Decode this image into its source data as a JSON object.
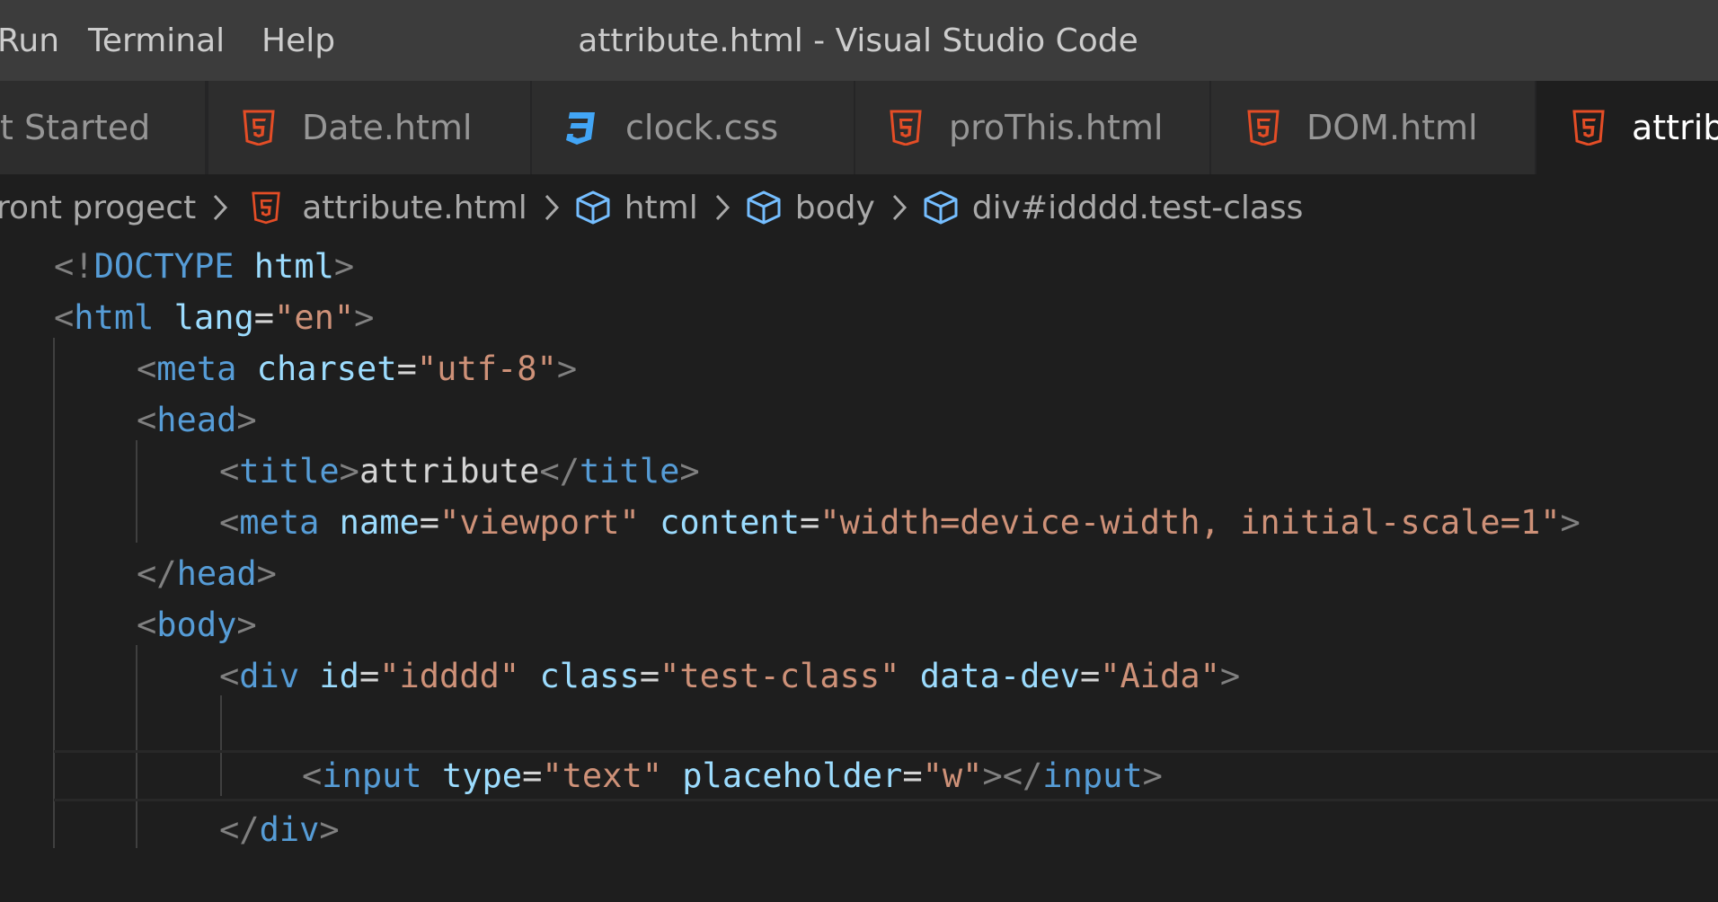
{
  "window": {
    "title": "attribute.html - Visual Studio Code"
  },
  "menu": {
    "run": "Run",
    "terminal": "Terminal",
    "help": "Help"
  },
  "tabs": [
    {
      "label": "t Started",
      "icon": "vscode-welcome-icon",
      "active": false
    },
    {
      "label": "Date.html",
      "icon": "html5-icon",
      "active": false
    },
    {
      "label": "clock.css",
      "icon": "css3-icon",
      "active": false
    },
    {
      "label": "proThis.html",
      "icon": "html5-icon",
      "active": false
    },
    {
      "label": "DOM.html",
      "icon": "html5-icon",
      "active": false
    },
    {
      "label": "attribu",
      "icon": "html5-icon",
      "active": true
    }
  ],
  "breadcrumb": {
    "folder": "ront progect",
    "file": "attribute.html",
    "html": "html",
    "body": "body",
    "div": "div#idddd.test-class"
  },
  "code": {
    "l1": {
      "open": "<!",
      "doctype": "DOCTYPE",
      "html": "html",
      "close": ">"
    },
    "l2": {
      "lt": "<",
      "tag": "html",
      "attr": "lang",
      "eq": "=",
      "val": "\"en\"",
      "gt": ">"
    },
    "l3": {
      "lt": "<",
      "tag": "meta",
      "attr": "charset",
      "eq": "=",
      "val": "\"utf-8\"",
      "gt": ">"
    },
    "l4": {
      "lt": "<",
      "tag": "head",
      "gt": ">"
    },
    "l5": {
      "lt": "<",
      "tag": "title",
      "gt": ">",
      "text": "attribute",
      "lt2": "</",
      "tag2": "title",
      "gt2": ">"
    },
    "l6": {
      "lt": "<",
      "tag": "meta",
      "attr1": "name",
      "eq": "=",
      "val1": "\"viewport\"",
      "attr2": "content",
      "val2": "\"width=device-width, initial-scale=1\"",
      "gt": ">"
    },
    "l7": {
      "lt": "</",
      "tag": "head",
      "gt": ">"
    },
    "l8": {
      "lt": "<",
      "tag": "body",
      "gt": ">"
    },
    "l9": {
      "lt": "<",
      "tag": "div",
      "attr1": "id",
      "eq": "=",
      "val1": "\"idddd\"",
      "attr2": "class",
      "val2": "\"test-class\"",
      "attr3": "data-dev",
      "val3": "\"Aida\"",
      "gt": ">"
    },
    "l11": {
      "lt": "<",
      "tag": "input",
      "attr1": "type",
      "eq": "=",
      "val1": "\"text\"",
      "attr2": "placeholder",
      "val2": "\"w\"",
      "gt": ">",
      "lt2": "</",
      "tag2": "input",
      "gt2": ">"
    },
    "l12": {
      "lt": "</",
      "tag": "div",
      "gt": ">"
    }
  },
  "colors": {
    "titlebar": "#3c3c3c",
    "tab_inactive": "#2d2d2d",
    "editor_bg": "#1e1e1e",
    "html_icon": "#e44d26",
    "css_icon": "#42a5f5",
    "tag": "#569cd6",
    "attribute": "#9cdcfe",
    "string": "#ce9178"
  }
}
